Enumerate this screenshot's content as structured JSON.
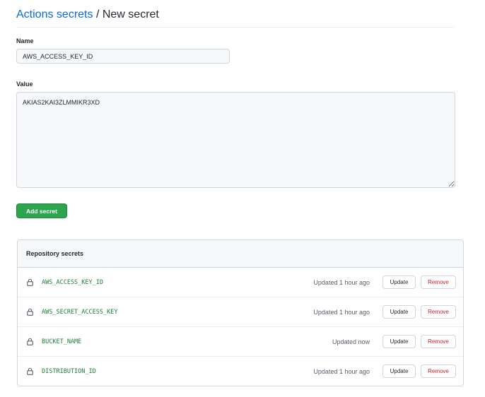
{
  "breadcrumb": {
    "parent": "Actions secrets",
    "separator": "/",
    "current": "New secret"
  },
  "form": {
    "name_label": "Name",
    "name_value": "AWS_ACCESS_KEY_ID",
    "value_label": "Value",
    "value_value": "AKIAS2KAI3ZLMMIKR3XD",
    "submit_label": "Add secret"
  },
  "secrets": {
    "title": "Repository secrets",
    "update_label": "Update",
    "remove_label": "Remove",
    "rows": [
      {
        "name": "AWS_ACCESS_KEY_ID",
        "updated": "Updated 1 hour ago"
      },
      {
        "name": "AWS_SECRET_ACCESS_KEY",
        "updated": "Updated 1 hour ago"
      },
      {
        "name": "BUCKET_NAME",
        "updated": "Updated now"
      },
      {
        "name": "DISTRIBUTION_ID",
        "updated": "Updated 1 hour ago"
      }
    ]
  },
  "icons": {
    "row_icon": "lock-icon"
  },
  "colors": {
    "link": "#0969da",
    "primary_button": "#2da44e",
    "secret_name": "#1a7f37",
    "danger": "#cf222e"
  }
}
